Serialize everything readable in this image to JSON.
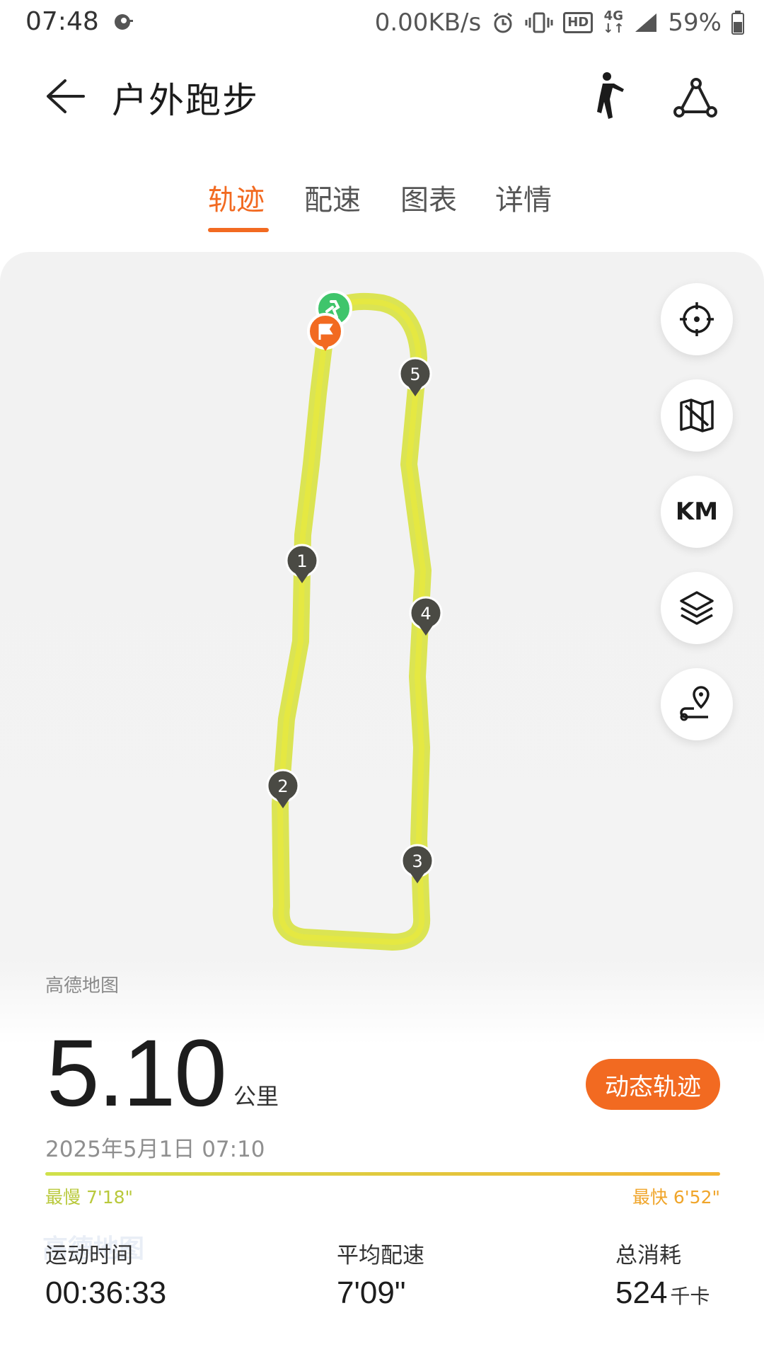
{
  "status_bar": {
    "time": "07:48",
    "net_speed": "0.00KB/s",
    "network_type": "4G",
    "hd_label": "HD",
    "battery": "59%"
  },
  "header": {
    "title": "户外跑步",
    "icons": [
      "back-arrow-icon",
      "runner-posture-icon",
      "route-share-icon"
    ]
  },
  "tabs": [
    {
      "label": "轨迹",
      "active": true
    },
    {
      "label": "配速",
      "active": false
    },
    {
      "label": "图表",
      "active": false
    },
    {
      "label": "详情",
      "active": false
    }
  ],
  "map": {
    "source": "高德地图",
    "watermark": "高德地图",
    "km_toggle": "KM",
    "markers": [
      "1",
      "2",
      "3",
      "4",
      "5"
    ],
    "controls": [
      "locate-icon",
      "map-style-icon",
      "km-toggle",
      "layers-icon",
      "route-pin-icon"
    ]
  },
  "summary": {
    "distance": "5.10",
    "distance_unit": "公里",
    "dynamic_track_button": "动态轨迹",
    "date": "2025年5月1日 07:10",
    "slowest": "最慢 7'18\"",
    "fastest": "最快 6'52\""
  },
  "stats": [
    {
      "label": "运动时间",
      "value": "00:36:33",
      "unit": ""
    },
    {
      "label": "平均配速",
      "value": "7'09\"",
      "unit": ""
    },
    {
      "label": "总消耗",
      "value": "524",
      "unit": "千卡"
    }
  ],
  "colors": {
    "accent": "#f26a21",
    "track": "#d9e34a",
    "marker": "#4a4a44",
    "start": "#3fc56b"
  }
}
